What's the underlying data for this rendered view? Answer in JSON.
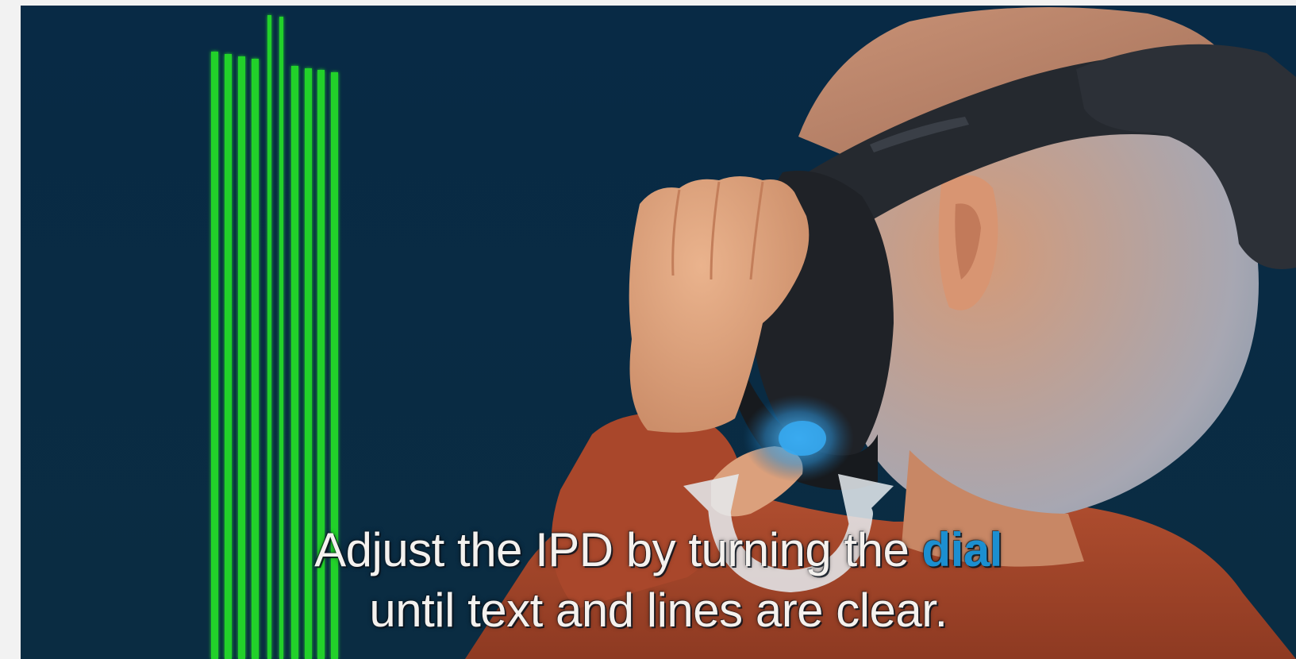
{
  "caption": {
    "line1_before": "Adjust the IPD by turning the",
    "line1_highlight": "dial",
    "line2": "until text and lines are clear."
  },
  "colors": {
    "background_top": "#082a45",
    "background_bottom": "#0a2b40",
    "test_lines": "#26d12a",
    "highlight_word": "#1c8fd0",
    "sweater": "#a8462a",
    "skin": "#e2a57f",
    "headset": "#262a30",
    "dial_glow": "#2aa7ee"
  },
  "icons": {
    "rotate_arrow": "rotate-arrow-icon",
    "headset": "vr-headset-icon"
  }
}
